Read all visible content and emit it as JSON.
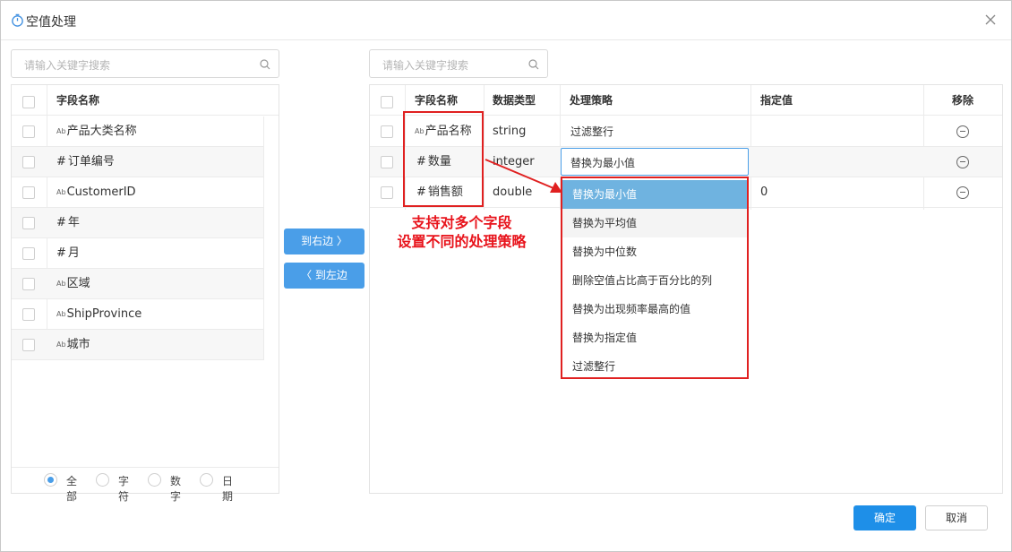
{
  "dialog": {
    "title": "空值处理",
    "close_icon": "close-icon",
    "title_icon": "clock-icon"
  },
  "left": {
    "search_placeholder": "请输入关键字搜索",
    "header": "字段名称",
    "fields": [
      {
        "type_icon": "Ab",
        "name": "产品大类名称"
      },
      {
        "type_icon": "#",
        "name": "订单编号"
      },
      {
        "type_icon": "Ab",
        "name": "CustomerID"
      },
      {
        "type_icon": "#",
        "name": "年"
      },
      {
        "type_icon": "#",
        "name": "月"
      },
      {
        "type_icon": "Ab",
        "name": "区域"
      },
      {
        "type_icon": "Ab",
        "name": "ShipProvince"
      },
      {
        "type_icon": "Ab",
        "name": "城市"
      }
    ],
    "filters": [
      "全部",
      "字符",
      "数字",
      "日期"
    ],
    "selected_filter": "全部"
  },
  "transfer": {
    "to_right": "到右边 〉",
    "to_left": "〈 到左边"
  },
  "right": {
    "search_placeholder": "请输入关键字搜索",
    "headers": [
      "字段名称",
      "数据类型",
      "处理策略",
      "指定值",
      "移除"
    ],
    "rows": [
      {
        "type_icon": "Ab",
        "name": "产品名称",
        "dtype": "string",
        "strategy": "过滤整行",
        "value": ""
      },
      {
        "type_icon": "#",
        "name": "数量",
        "dtype": "integer",
        "strategy": "替换为最小值",
        "value": ""
      },
      {
        "type_icon": "#",
        "name": "销售额",
        "dtype": "double",
        "strategy": "",
        "value": "0"
      }
    ]
  },
  "dropdown": {
    "options": [
      "替换为最小值",
      "替换为平均值",
      "替换为中位数",
      "删除空值占比高于百分比的列",
      "替换为出现频率最高的值",
      "替换为指定值",
      "过滤整行"
    ],
    "selected": "替换为最小值"
  },
  "annotation": {
    "line1": "支持对多个字段",
    "line2": "设置不同的处理策略",
    "color": "#e8141c"
  },
  "footer": {
    "ok": "确定",
    "cancel": "取消"
  },
  "colors": {
    "accent": "#4a9ee8",
    "ok": "#1e8fe8",
    "highlight": "#e02020"
  }
}
